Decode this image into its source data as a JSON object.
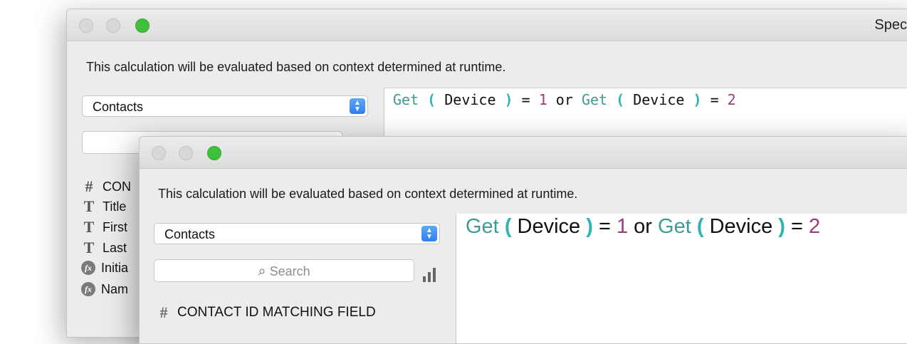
{
  "back_window": {
    "title": "Spec",
    "description": "This calculation will be evaluated based on context determined at runtime.",
    "table_select": "Contacts",
    "formula": {
      "get1": "Get",
      "open1": "(",
      "arg1": " Device ",
      "close1": ")",
      "eq1": " = ",
      "val1": "1",
      "or": " or ",
      "get2": "Get",
      "open2": "(",
      "arg2": " Device ",
      "close2": ")",
      "eq2": " = ",
      "val2": "2"
    },
    "fields": [
      {
        "icon": "number-icon",
        "label": "CON"
      },
      {
        "icon": "text-icon",
        "label": "Title"
      },
      {
        "icon": "text-icon",
        "label": "First"
      },
      {
        "icon": "text-icon",
        "label": "Last"
      },
      {
        "icon": "calculation-icon",
        "label": "Initia"
      },
      {
        "icon": "calculation-icon",
        "label": "Nam"
      }
    ]
  },
  "front_window": {
    "description": "This calculation will be evaluated based on context determined at runtime.",
    "table_select": "Contacts",
    "search_placeholder": "Search",
    "formula": {
      "get1": "Get",
      "open1": "(",
      "arg1": " Device ",
      "close1": ")",
      "eq1": " = ",
      "val1": "1",
      "or": " or ",
      "get2": "Get",
      "open2": "(",
      "arg2": " Device ",
      "close2": ")",
      "eq2": " = ",
      "val2": "2"
    },
    "fields": [
      {
        "icon": "number-icon",
        "label": "CONTACT ID MATCHING FIELD"
      }
    ]
  },
  "icons": {
    "number": "#",
    "text": "T",
    "calculation": "fx",
    "magnifier": "⌕",
    "select_arrows": "▲▼"
  }
}
